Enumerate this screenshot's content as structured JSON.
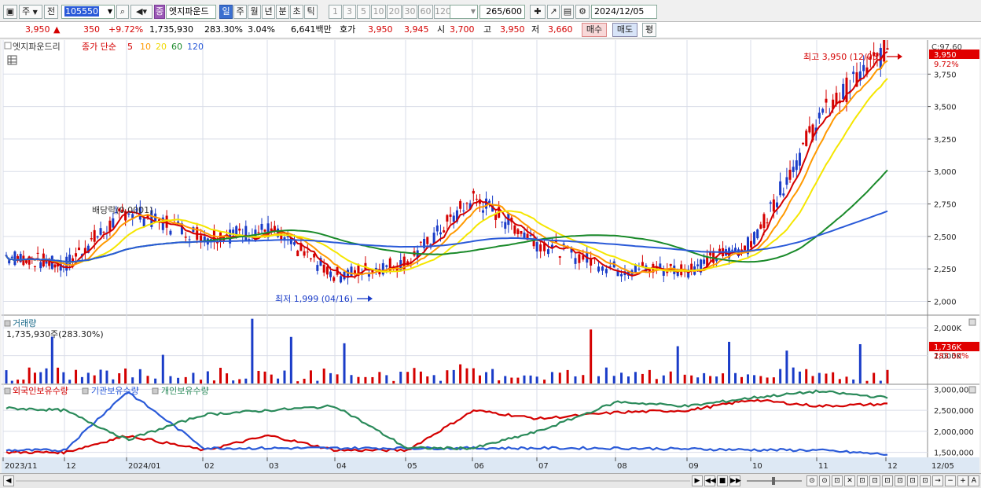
{
  "toolbar": {
    "market_label": "주",
    "prev_label": "전",
    "code": "105550",
    "name": "엣지파운드",
    "name_badge": "중",
    "periods": [
      "일",
      "주",
      "월",
      "년",
      "분",
      "초",
      "틱"
    ],
    "selected_period": "일",
    "intervals": [
      "1",
      "3",
      "5",
      "10",
      "20",
      "30",
      "60",
      "120"
    ],
    "count": "265",
    "count_max": "/600",
    "date": "2024/12/05"
  },
  "quote": {
    "price": "3,950",
    "price_arrow": "▲",
    "change": "350",
    "change_pct": "+9.72%",
    "volume": "1,735,930",
    "volume_ratio": "283.30%",
    "turnover": "3.04%",
    "amount": "6,641백만",
    "bid_label": "호가",
    "bid1": "3,950",
    "bid2": "3,945",
    "open_label": "시",
    "open": "3,700",
    "high_label": "고",
    "high": "3,950",
    "low_label": "저",
    "low": "3,660",
    "buy_label": "매수",
    "sell_label": "매도",
    "eval_label": "평"
  },
  "price_panel": {
    "title": "엣지파운드리",
    "ma_label": "종가 단순",
    "ma_periods": [
      "5",
      "10",
      "20",
      "60",
      "120"
    ],
    "ma_colors": [
      "#d40000",
      "#ff9900",
      "#f5e600",
      "#1a8a2a",
      "#2a5ad8"
    ],
    "y_ticks": [
      "3,750",
      "3,500",
      "3,250",
      "3,000",
      "2,750",
      "2,500",
      "2,250",
      "2,000"
    ],
    "y_tick_values": [
      3750,
      3500,
      3250,
      3000,
      2750,
      2500,
      2250,
      2000
    ],
    "corner_label": "C:97.60",
    "current_price_tag": "3,950",
    "current_pct_tag": "9.72%",
    "high_annotation": "최고 3,950 (12/05)",
    "low_annotation": "최저 1,999 (04/16)",
    "dividend_annotation": "배당락(0.0001)"
  },
  "volume_panel": {
    "title": "거래량",
    "value_label": "1,735,930주(283.30%)",
    "y_ticks": [
      "2,000K",
      "1,000K"
    ],
    "y_tick_values": [
      2000,
      1000
    ],
    "current_tag": "1,736K",
    "current_pct_tag": "283.30%"
  },
  "holdings_panel": {
    "legend": [
      "외국인보유수량",
      "기관보유수량",
      "개인보유수량"
    ],
    "legend_colors": [
      "#d40000",
      "#2a5ad8",
      "#2a8a5a"
    ],
    "y_ticks": [
      "3,000,000",
      "2,500,000",
      "2,000,000",
      "1,500,000"
    ],
    "y_tick_values": [
      3000000,
      2500000,
      2000000,
      1500000
    ]
  },
  "x_axis": {
    "labels": [
      "2023/11",
      "12",
      "2024/01",
      "02",
      "03",
      "04",
      "05",
      "06",
      "07",
      "08",
      "09",
      "10",
      "11",
      "12",
      "12/05"
    ]
  },
  "colors": {
    "up": "#d40000",
    "down": "#1a3cc8",
    "grid": "#d9dde8",
    "panel_bg": "#ffffff"
  },
  "chart_data": {
    "type": "line",
    "x_range": [
      "2023/11",
      "2024/12/05"
    ],
    "price_close_monthly": [
      {
        "x": "2023/11",
        "y": 2350
      },
      {
        "x": "2023/12",
        "y": 2280
      },
      {
        "x": "2024/01",
        "y": 2700
      },
      {
        "x": "2024/02",
        "y": 2500
      },
      {
        "x": "2024/03",
        "y": 2550
      },
      {
        "x": "2024/04",
        "y": 2200
      },
      {
        "x": "2024/05",
        "y": 2300
      },
      {
        "x": "2024/06",
        "y": 2800
      },
      {
        "x": "2024/07",
        "y": 2450
      },
      {
        "x": "2024/08",
        "y": 2250
      },
      {
        "x": "2024/09",
        "y": 2250
      },
      {
        "x": "2024/10",
        "y": 2450
      },
      {
        "x": "2024/11",
        "y": 3400
      },
      {
        "x": "2024/12",
        "y": 3950
      }
    ],
    "price_ylim": [
      1900,
      4000
    ],
    "volume_ylim": [
      0,
      2400
    ],
    "holdings_ylim": [
      1400000,
      3100000
    ],
    "foreign_holdings": [
      1500000,
      1500000,
      1900000,
      1550000,
      1900000,
      1550000,
      1550000,
      2500000,
      2300000,
      2450000,
      2500000,
      2750000,
      2600000,
      2650000
    ],
    "institution_holdings": [
      1550000,
      1550000,
      2950000,
      1600000,
      1600000,
      1600000,
      1600000,
      1600000,
      1600000,
      1600000,
      1580000,
      1560000,
      1550000,
      1450000
    ],
    "individual_holdings": [
      2550000,
      2500000,
      1800000,
      2400000,
      2500000,
      2600000,
      1600000,
      1600000,
      2000000,
      2700000,
      2600000,
      2800000,
      2950000,
      2800000
    ]
  }
}
